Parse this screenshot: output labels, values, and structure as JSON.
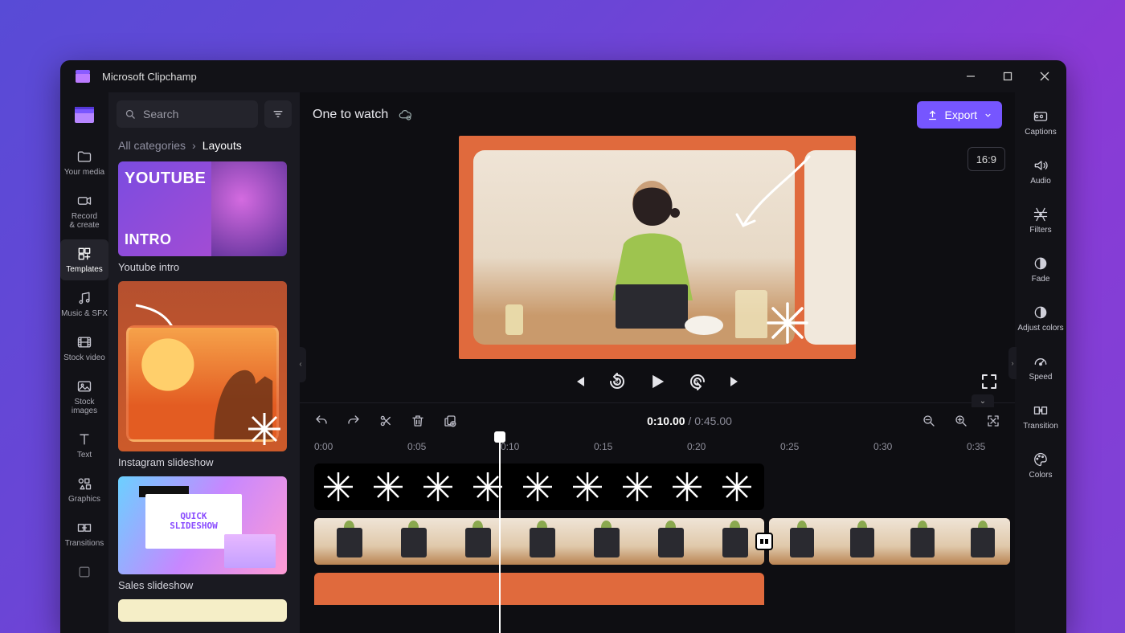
{
  "app": {
    "title": "Microsoft Clipchamp"
  },
  "nav": {
    "items": [
      {
        "label": "Your media",
        "icon": "folder"
      },
      {
        "label": "Record\n& create",
        "icon": "camera"
      },
      {
        "label": "Templates",
        "icon": "templates"
      },
      {
        "label": "Music & SFX",
        "icon": "music"
      },
      {
        "label": "Stock video",
        "icon": "video"
      },
      {
        "label": "Stock\nimages",
        "icon": "image"
      },
      {
        "label": "Text",
        "icon": "text"
      },
      {
        "label": "Graphics",
        "icon": "graphics"
      },
      {
        "label": "Transitions",
        "icon": "transitions"
      }
    ],
    "active_index": 2
  },
  "search": {
    "placeholder": "Search"
  },
  "breadcrumb": {
    "root": "All categories",
    "current": "Layouts"
  },
  "templates": [
    {
      "label": "Youtube intro",
      "tile_top": "YOUTUBE",
      "tile_bottom": "INTRO"
    },
    {
      "label": "Instagram slideshow"
    },
    {
      "label": "Sales slideshow",
      "tile_text": "QUICK\nSLIDESHOW"
    }
  ],
  "project": {
    "title": "One to watch"
  },
  "export": {
    "label": "Export"
  },
  "aspect": {
    "label": "16:9"
  },
  "time": {
    "current": "0:10.00",
    "sep": " / ",
    "total": "0:45.00"
  },
  "ruler": [
    "0:00",
    "0:05",
    "0:10",
    "0:15",
    "0:20",
    "0:25",
    "0:30",
    "0:35"
  ],
  "props": [
    {
      "label": "Captions",
      "icon": "cc"
    },
    {
      "label": "Audio",
      "icon": "audio"
    },
    {
      "label": "Filters",
      "icon": "filters"
    },
    {
      "label": "Fade",
      "icon": "fade"
    },
    {
      "label": "Adjust colors",
      "icon": "adjust"
    },
    {
      "label": "Speed",
      "icon": "speed"
    },
    {
      "label": "Transition",
      "icon": "transition"
    },
    {
      "label": "Colors",
      "icon": "colors"
    }
  ],
  "colors": {
    "accent": "#7656ff",
    "canvas_bg": "#e06a3d"
  }
}
